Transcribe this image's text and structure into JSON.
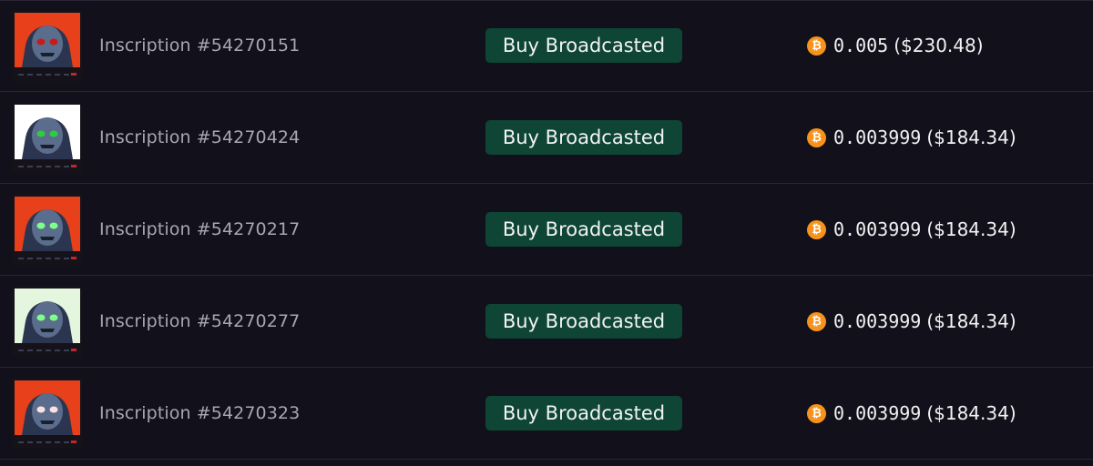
{
  "rows": [
    {
      "name": "Inscription #54270151",
      "status": "Buy Broadcasted",
      "btc_symbol": "₿",
      "amount": "0.005",
      "usd": "($230.48)",
      "thumb_bg": "#e8401a",
      "eye_color": "#c71b1b"
    },
    {
      "name": "Inscription #54270424",
      "status": "Buy Broadcasted",
      "btc_symbol": "₿",
      "amount": "0.003999",
      "usd": "($184.34)",
      "thumb_bg": "#ffffff",
      "eye_color": "#2ecc40"
    },
    {
      "name": "Inscription #54270217",
      "status": "Buy Broadcasted",
      "btc_symbol": "₿",
      "amount": "0.003999",
      "usd": "($184.34)",
      "thumb_bg": "#e8401a",
      "eye_color": "#7dff8a"
    },
    {
      "name": "Inscription #54270277",
      "status": "Buy Broadcasted",
      "btc_symbol": "₿",
      "amount": "0.003999",
      "usd": "($184.34)",
      "thumb_bg": "#e4f7de",
      "eye_color": "#7dff8a"
    },
    {
      "name": "Inscription #54270323",
      "status": "Buy Broadcasted",
      "btc_symbol": "₿",
      "amount": "0.003999",
      "usd": "($184.34)",
      "thumb_bg": "#e8401a",
      "eye_color": "#ffe0e0"
    }
  ],
  "colors": {
    "background": "#12101a",
    "status_bg": "#0e4535",
    "btc_orange": "#f7931a"
  }
}
